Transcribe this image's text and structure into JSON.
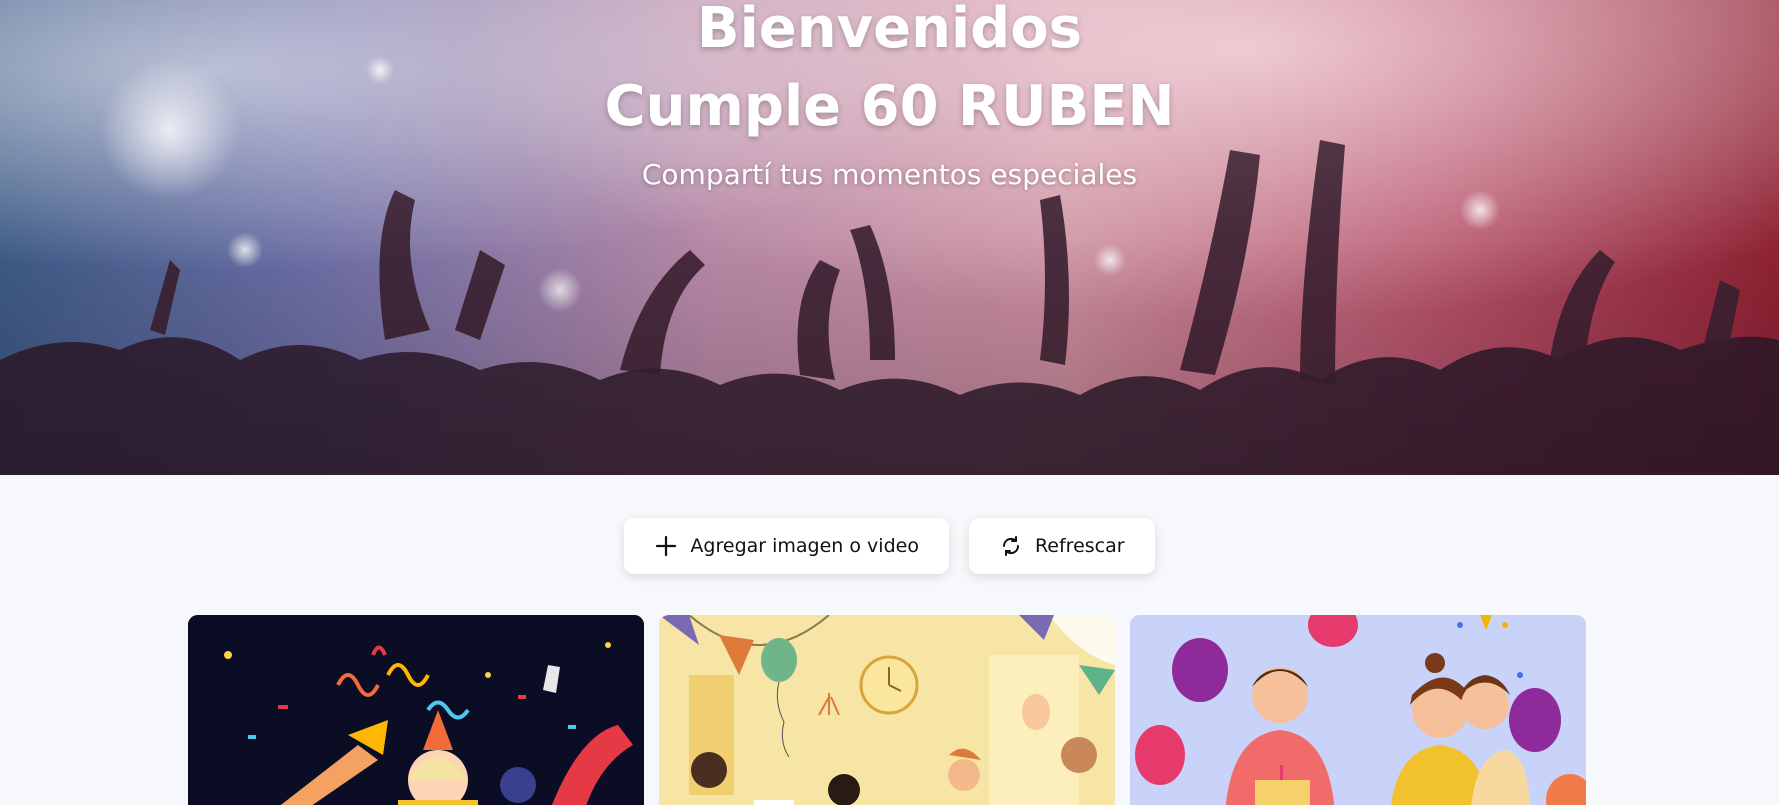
{
  "hero": {
    "title_line1": "Bienvenidos",
    "title_line2": "Cumple 60 RUBEN",
    "subtitle": "Compartí tus momentos especiales"
  },
  "actions": {
    "add_label": "Agregar imagen o video",
    "add_icon": "plus-icon",
    "refresh_label": "Refrescar",
    "refresh_icon": "refresh-icon"
  },
  "gallery": {
    "items": [
      {
        "type": "image",
        "theme": "party-confetti-night"
      },
      {
        "type": "image",
        "theme": "office-party-balloons"
      },
      {
        "type": "image",
        "theme": "surprise-birthday-cake"
      }
    ]
  },
  "colors": {
    "page_bg": "#f7f8fb",
    "button_bg": "#ffffff",
    "text_dark": "#111111"
  }
}
